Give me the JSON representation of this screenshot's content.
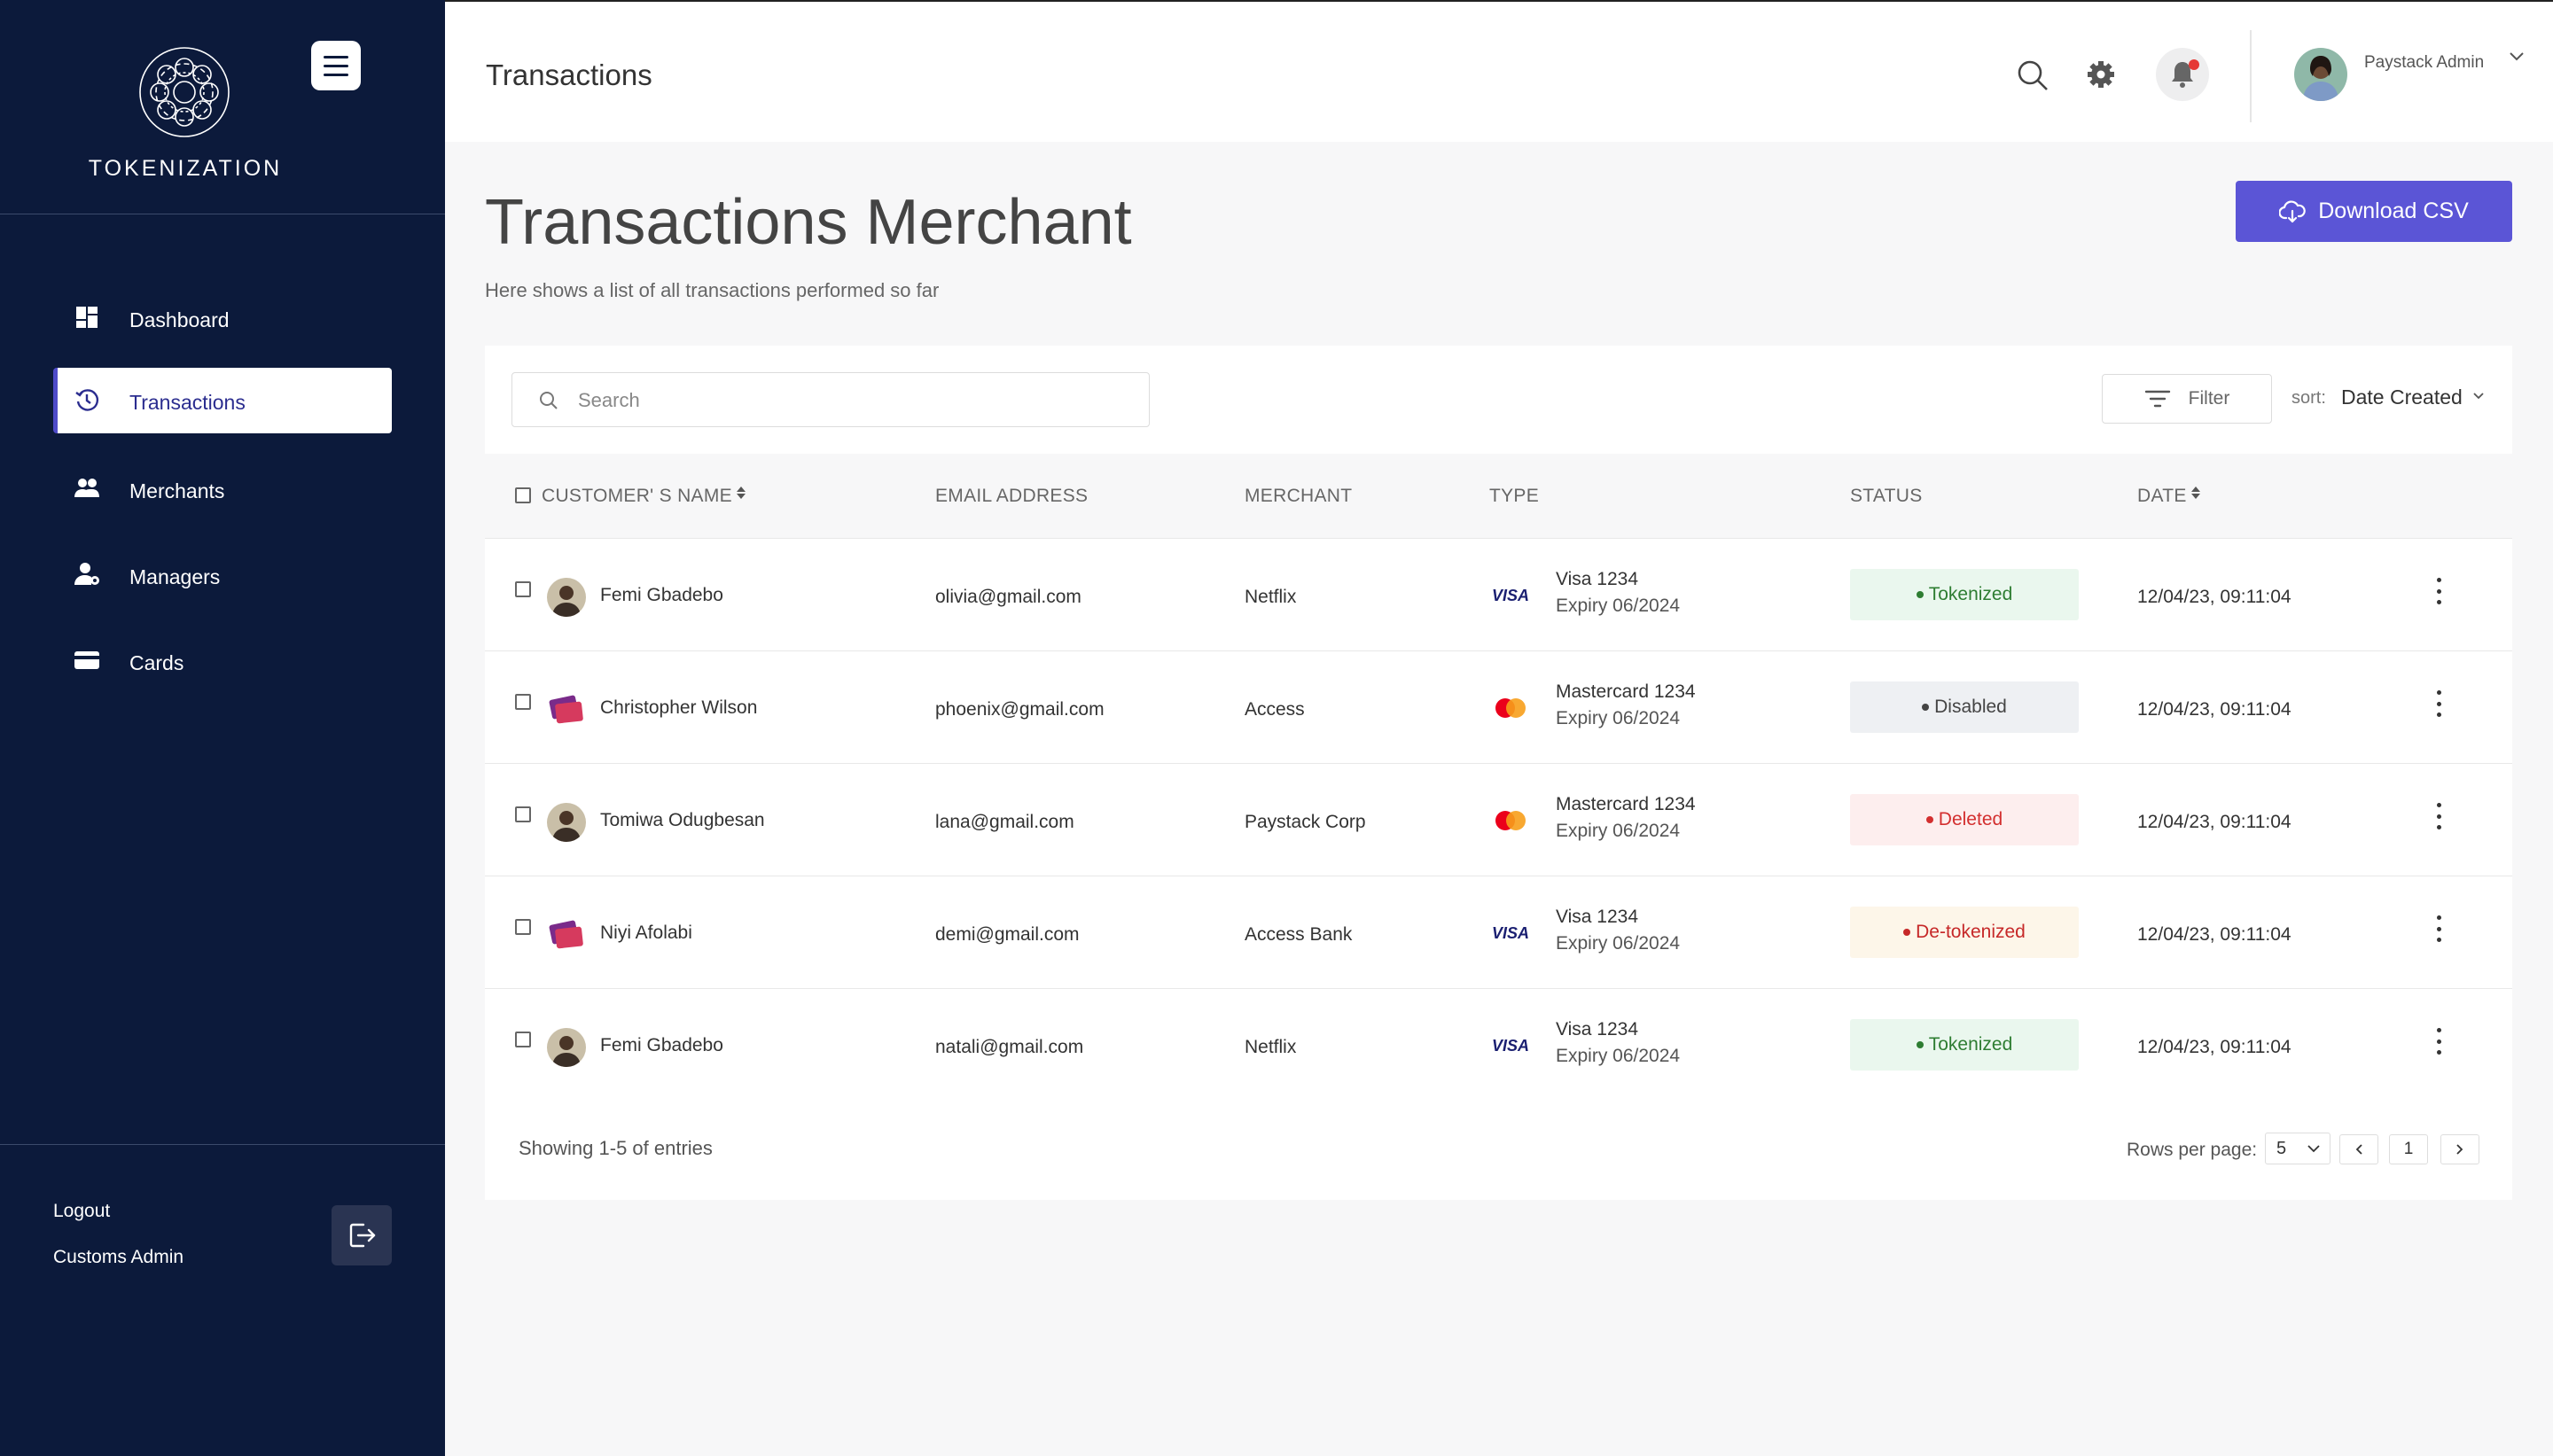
{
  "app": {
    "brand": "TOKENIZATION"
  },
  "sidebar": {
    "items": [
      {
        "label": "Dashboard",
        "icon": "dashboard-icon"
      },
      {
        "label": "Transactions",
        "icon": "history-icon",
        "active": true
      },
      {
        "label": "Merchants",
        "icon": "people-icon"
      },
      {
        "label": "Managers",
        "icon": "manager-icon"
      },
      {
        "label": "Cards",
        "icon": "card-icon"
      }
    ],
    "logout_label": "Logout",
    "admin_label": "Customs Admin"
  },
  "header": {
    "title": "Transactions",
    "user_name": "Paystack Admin"
  },
  "page": {
    "title": "Transactions Merchant",
    "subtitle": "Here shows a list of all transactions performed so far",
    "download_label": "Download CSV"
  },
  "toolbar": {
    "search_placeholder": "Search",
    "filter_label": "Filter",
    "sort_label": "sort:",
    "sort_value": "Date Created"
  },
  "table": {
    "columns": [
      "CUSTOMER' S NAME",
      "EMAIL ADDRESS",
      "MERCHANT",
      "TYPE",
      "STATUS",
      "DATE"
    ],
    "rows": [
      {
        "name": "Femi Gbadebo",
        "email": "olivia@gmail.com",
        "merchant": "Netflix",
        "card": "Visa 1234",
        "expiry": "Expiry 06/2024",
        "card_brand": "visa",
        "status": "Tokenized",
        "date": "12/04/23, 09:11:04"
      },
      {
        "name": "Christopher Wilson",
        "email": "phoenix@gmail.com",
        "merchant": "Access",
        "card": "Mastercard 1234",
        "expiry": "Expiry 06/2024",
        "card_brand": "mastercard",
        "status": "Disabled",
        "date": "12/04/23, 09:11:04"
      },
      {
        "name": "Tomiwa Odugbesan",
        "email": "lana@gmail.com",
        "merchant": "Paystack Corp",
        "card": "Mastercard 1234",
        "expiry": "Expiry 06/2024",
        "card_brand": "mastercard",
        "status": "Deleted",
        "date": "12/04/23, 09:11:04"
      },
      {
        "name": "Niyi Afolabi",
        "email": "demi@gmail.com",
        "merchant": "Access Bank",
        "card": "Visa 1234",
        "expiry": "Expiry 06/2024",
        "card_brand": "visa",
        "status": "De-tokenized",
        "date": "12/04/23, 09:11:04"
      },
      {
        "name": "Femi Gbadebo",
        "email": "natali@gmail.com",
        "merchant": "Netflix",
        "card": "Visa 1234",
        "expiry": "Expiry 06/2024",
        "card_brand": "visa",
        "status": "Tokenized",
        "date": "12/04/23, 09:11:04"
      }
    ]
  },
  "footer": {
    "showing": "Showing 1-5 of entries",
    "rows_per_page_label": "Rows per page:",
    "rows_per_page": "5",
    "current_page": "1"
  },
  "colors": {
    "sidebar_bg": "#0c1a3b",
    "accent": "#5b55d6",
    "tokenized": "#2e7d32",
    "disabled": "#555555",
    "deleted": "#d32f2f",
    "detokenized": "#c62828"
  }
}
